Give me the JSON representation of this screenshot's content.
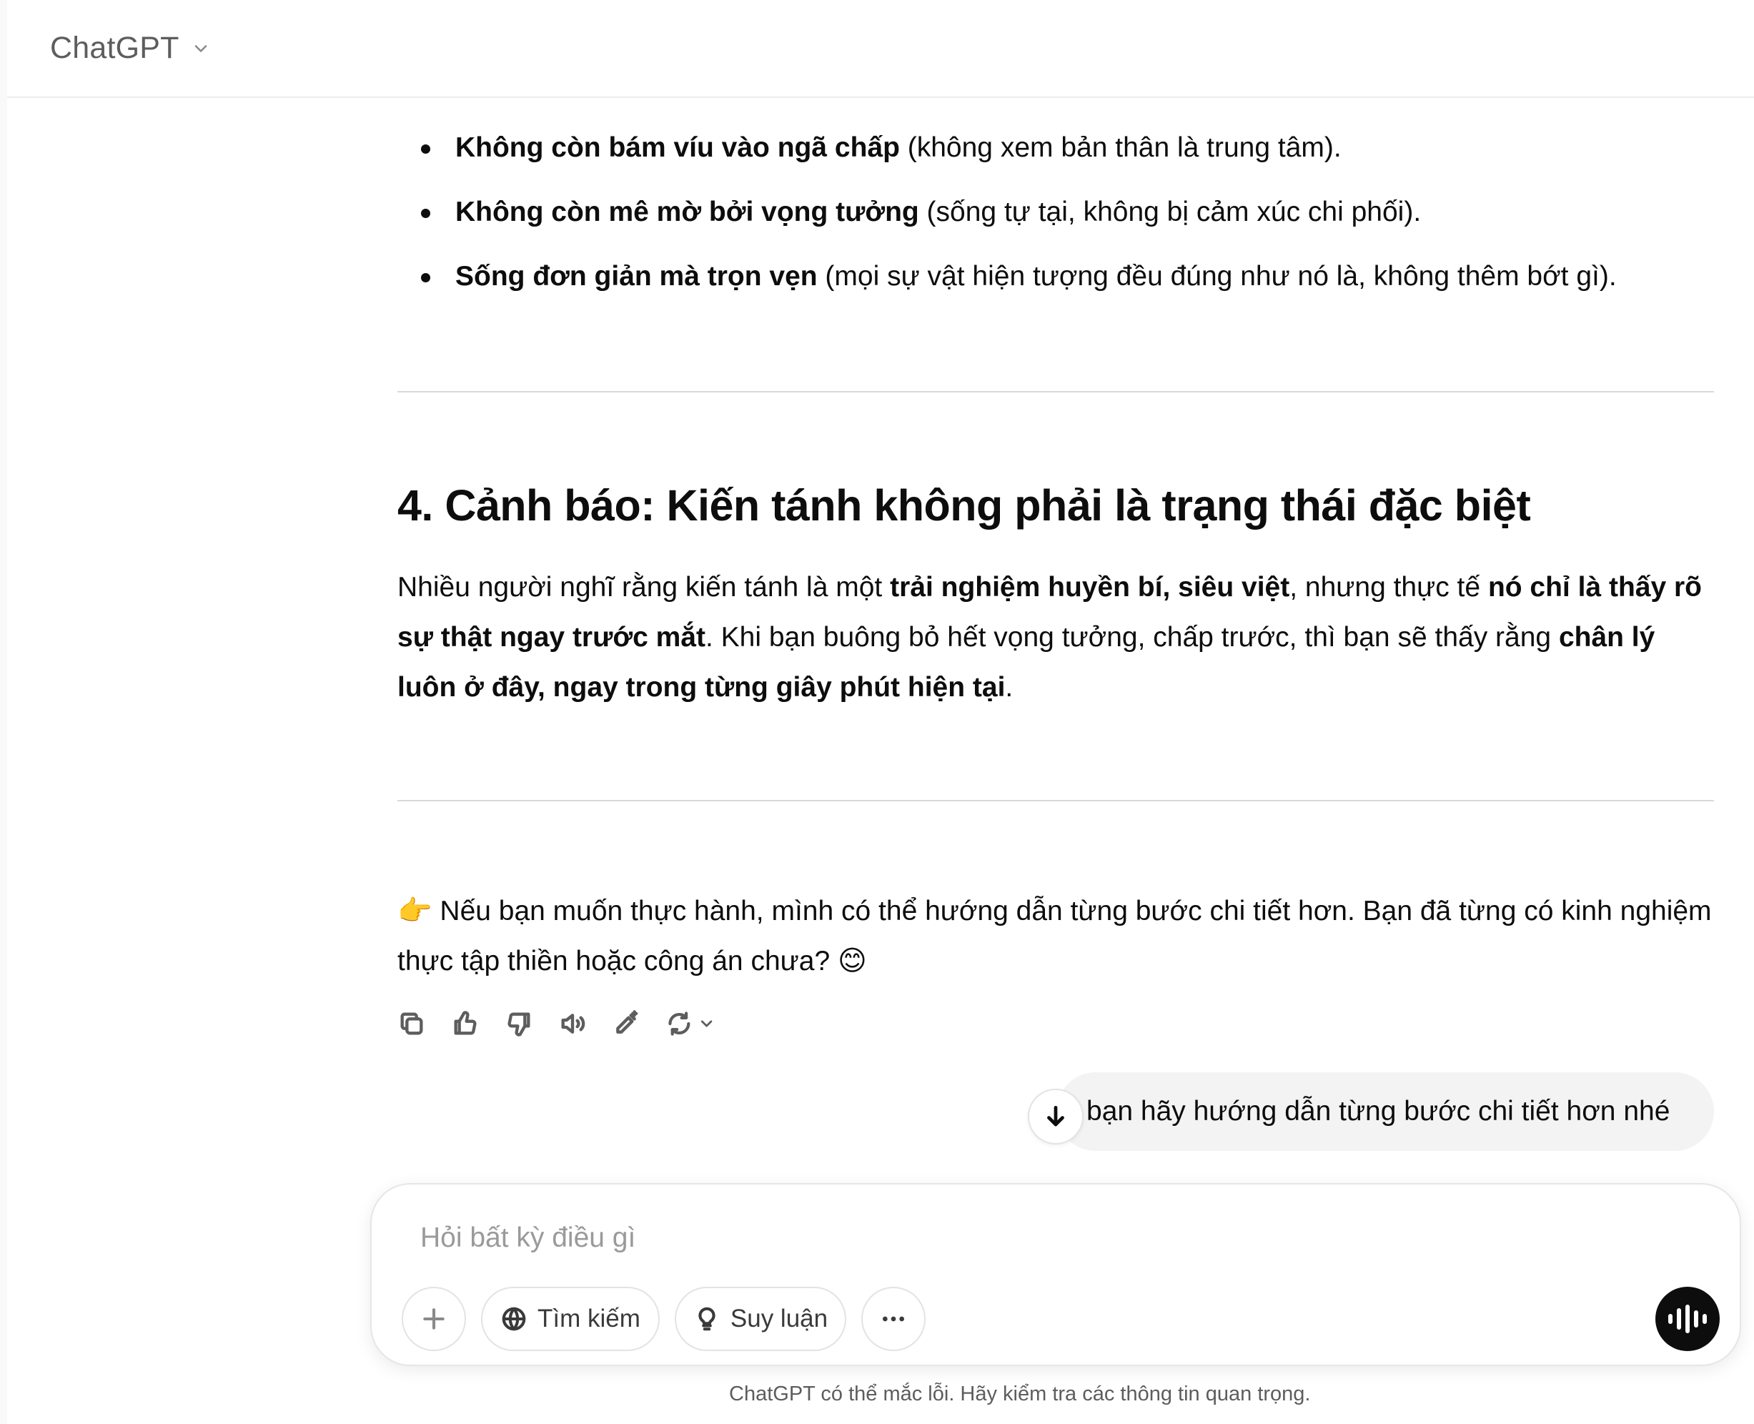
{
  "header": {
    "model_name": "ChatGPT"
  },
  "bullets": [
    {
      "bold": "Không còn bám víu vào ngã chấp",
      "rest": " (không xem bản thân là trung tâm)."
    },
    {
      "bold": "Không còn mê mờ bởi vọng tưởng",
      "rest": " (sống tự tại, không bị cảm xúc chi phối)."
    },
    {
      "bold": "Sống đơn giản mà trọn vẹn",
      "rest": " (mọi sự vật hiện tượng đều đúng như nó là, không thêm bớt gì)."
    }
  ],
  "section": {
    "title": "4. Cảnh báo: Kiến tánh không phải là trạng thái đặc biệt",
    "p1": "Nhiều người nghĩ rằng kiến tánh là một ",
    "b1": "trải nghiệm huyền bí, siêu việt",
    "p2": ", nhưng thực tế ",
    "b2": "nó chỉ là thấy rõ sự thật ngay trước mắt",
    "p3": ". Khi bạn buông bỏ hết vọng tưởng, chấp trước, thì bạn sẽ thấy rằng ",
    "b3": "chân lý luôn ở đây, ngay trong từng giây phút hiện tại",
    "p4": "."
  },
  "closing": {
    "emoji_pointer": "👉",
    "text": " Nếu bạn muốn thực hành, mình có thể hướng dẫn từng bước chi tiết hơn. Bạn đã từng có kinh nghiệm thực tập thiền hoặc công án chưa? ",
    "emoji_smile": "😊"
  },
  "user_message": "bạn hãy hướng dẫn từng bước chi tiết hơn nhé",
  "composer": {
    "placeholder": "Hỏi bất kỳ điều gì",
    "search_label": "Tìm kiếm",
    "reason_label": "Suy luận"
  },
  "disclaimer": "ChatGPT có thể mắc lỗi. Hãy kiểm tra các thông tin quan trọng."
}
